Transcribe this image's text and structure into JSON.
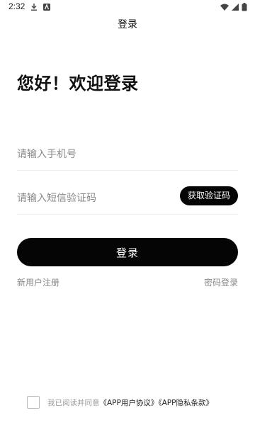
{
  "status_bar": {
    "time": "2:32",
    "icons": [
      "download-icon",
      "app-notification-icon",
      "wifi-icon",
      "signal-icon",
      "battery-icon"
    ]
  },
  "nav": {
    "title": "登录"
  },
  "greeting": "您好！欢迎登录",
  "phone_input": {
    "placeholder": "请输入手机号",
    "value": ""
  },
  "code_input": {
    "placeholder": "请输入短信验证码",
    "value": ""
  },
  "get_code_label": "获取验证码",
  "login_label": "登录",
  "register_label": "新用户注册",
  "password_login_label": "密码登录",
  "agreement": {
    "checked": false,
    "prefix": "我已阅读并同意",
    "user_agreement": "《APP用户协议》",
    "privacy_policy": "《APP隐私条款》"
  },
  "colors": {
    "background": "#ffffff",
    "primary": "#050505",
    "placeholder": "#8a8a8a",
    "muted_text": "#9a9a9a",
    "divider": "#ececec"
  }
}
